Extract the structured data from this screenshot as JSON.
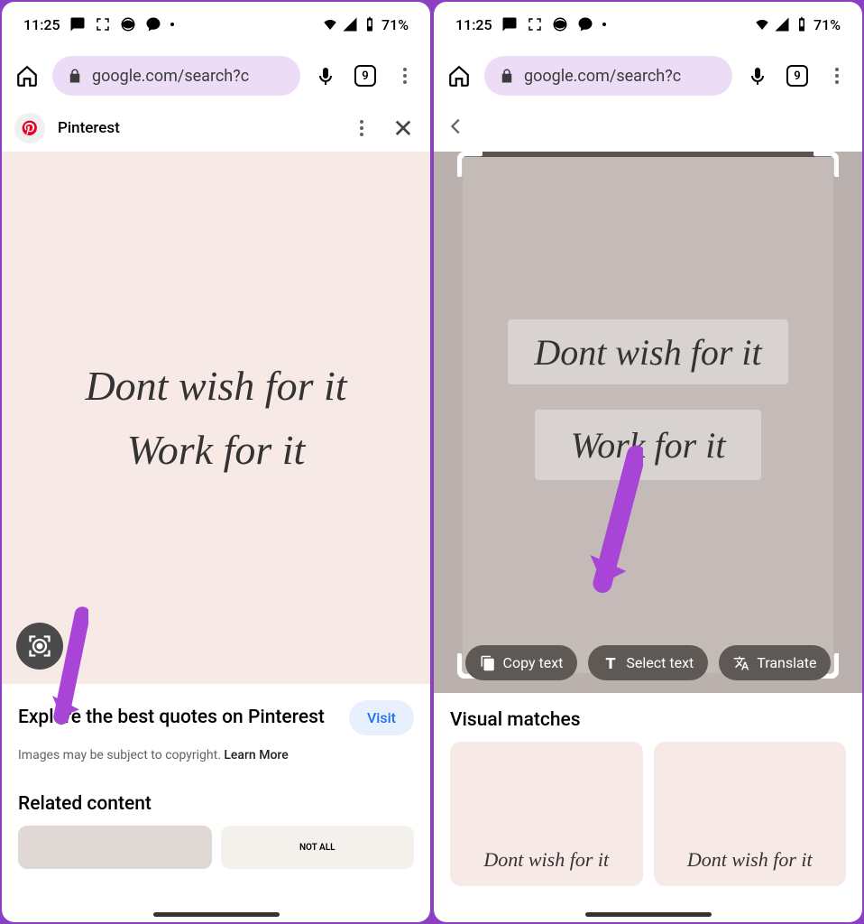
{
  "status": {
    "time": "11:25",
    "battery": "71%"
  },
  "chrome": {
    "url": "google.com/search?c",
    "tabs": "9"
  },
  "left": {
    "source": "Pinterest",
    "quote1": "Dont wish for it",
    "quote2": "Work for it",
    "title": "Explore the best quotes on Pinterest",
    "visit": "Visit",
    "copyright": "Images may be subject to copyright. ",
    "learn": "Learn More",
    "related": "Related content",
    "thumb2text": "NOT ALL"
  },
  "right": {
    "quote1": "Dont wish for it",
    "quote2": "Work for it",
    "copy": "Copy text",
    "select": "Select text",
    "translate": "Translate",
    "vm_heading": "Visual matches",
    "vm_text": "Dont wish for it"
  }
}
